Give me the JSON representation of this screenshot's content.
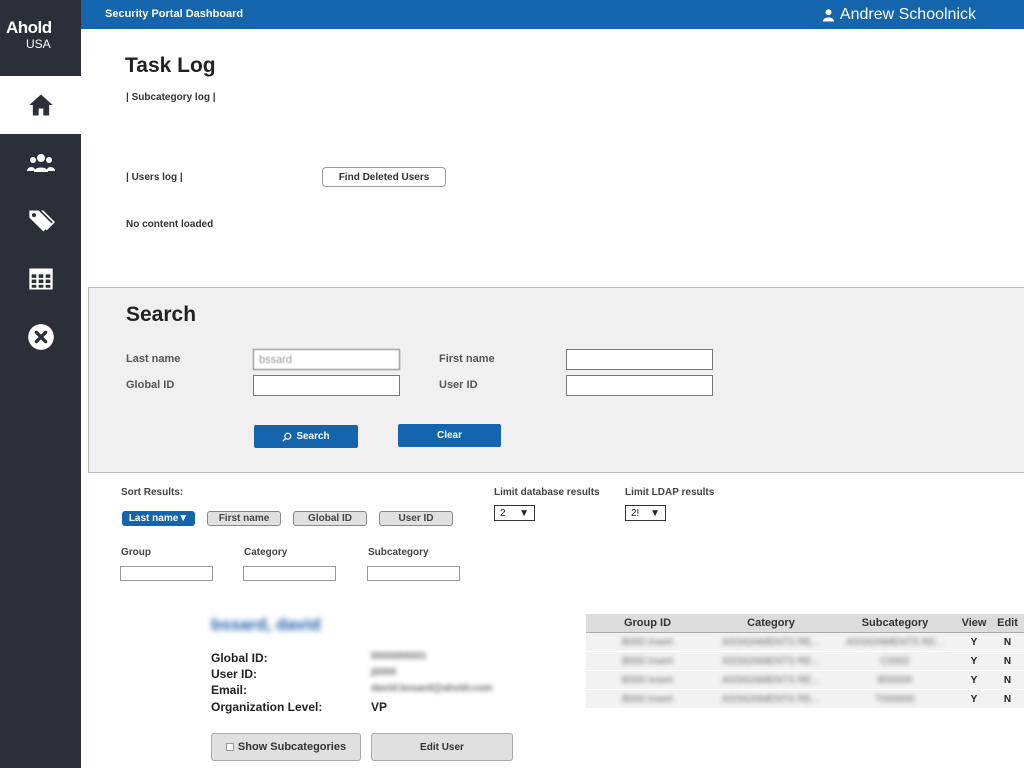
{
  "app": {
    "logo_line1": "Ahold",
    "logo_line2": "USA",
    "title": "Security Portal Dashboard",
    "user_name": "Andrew Schoolnick"
  },
  "sidebar": {
    "items": [
      {
        "icon": "home-icon",
        "active": true
      },
      {
        "icon": "users-icon",
        "active": false
      },
      {
        "icon": "tags-icon",
        "active": false
      },
      {
        "icon": "table-icon",
        "active": false
      },
      {
        "icon": "close-circle-icon",
        "active": false
      }
    ]
  },
  "tasklog": {
    "title": "Task Log",
    "subcategory_log": "| Subcategory log |",
    "users_log": "| Users log |",
    "find_deleted_users": "Find Deleted Users",
    "no_content": "No content loaded"
  },
  "search": {
    "title": "Search",
    "last_name_label": "Last name",
    "last_name_value": "bssard",
    "first_name_label": "First name",
    "first_name_value": "",
    "global_id_label": "Global ID",
    "global_id_value": "",
    "user_id_label": "User ID",
    "user_id_value": "",
    "search_button": "Search",
    "clear_button": "Clear"
  },
  "sort": {
    "label": "Sort Results:",
    "options": [
      "Last name▼",
      "First name",
      "Global ID",
      "User ID"
    ],
    "limit_db_label": "Limit database results",
    "limit_db_value": "2",
    "limit_ldap_label": "Limit LDAP results",
    "limit_ldap_value": "2!"
  },
  "filters": {
    "group_label": "Group",
    "category_label": "Category",
    "subcategory_label": "Subcategory"
  },
  "result": {
    "name": "bssard, david",
    "global_id_label": "Global ID:",
    "global_id_value": "0000000001",
    "user_id_label": "User ID:",
    "user_id_value": "j0000",
    "email_label": "Email:",
    "email_value": "david.bssard@ahold.com",
    "org_level_label": "Organization Level:",
    "org_level_value": "VP",
    "show_subcategories": "Show Subcategories",
    "edit_user": "Edit User"
  },
  "table": {
    "headers": [
      "Group ID",
      "Category",
      "Subcategory",
      "View",
      "Edit"
    ],
    "rows": [
      [
        "B000 Insert",
        "ASSIGNMENTS RE...",
        "ASSIGNMENTS RE...",
        "Y",
        "N"
      ],
      [
        "B000 Insert",
        "ASSIGNMENTS RE...",
        "C0002",
        "Y",
        "N"
      ],
      [
        "B000 Insert",
        "ASSIGNMENTS RE...",
        "B00000",
        "Y",
        "N"
      ],
      [
        "B000 Insert",
        "ASSIGNMENTS RE...",
        "T000000",
        "Y",
        "N"
      ]
    ]
  },
  "colors": {
    "accent": "#1565ad",
    "sidebar": "#2b2f38"
  }
}
